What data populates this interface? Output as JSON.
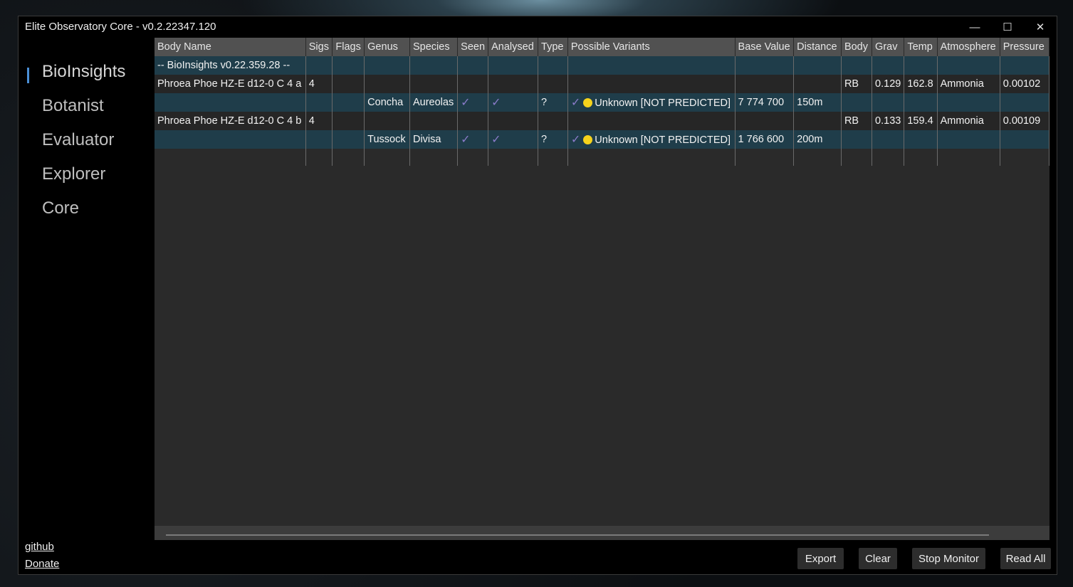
{
  "window": {
    "title": "Elite Observatory Core - v0.2.22347.120",
    "minimize_glyph": "—",
    "maximize_glyph": "☐",
    "close_glyph": "✕"
  },
  "sidebar": {
    "items": [
      {
        "label": "BioInsights",
        "active": true
      },
      {
        "label": "Botanist"
      },
      {
        "label": "Evaluator"
      },
      {
        "label": "Explorer"
      },
      {
        "label": "Core"
      }
    ],
    "links": {
      "github": "github",
      "donate": "Donate"
    }
  },
  "table": {
    "columns": [
      "Body Name",
      "Sigs",
      "Flags",
      "Genus",
      "Species",
      "Seen",
      "Analysed",
      "Type",
      "Possible Variants",
      "Base Value",
      "Distance",
      "Body",
      "Grav",
      "Temp",
      "Atmosphere",
      "Pressure"
    ],
    "rows": [
      {
        "body_name": "-- BioInsights v0.22.359.28  --",
        "sigs": "",
        "flags": "",
        "genus": "",
        "species": "",
        "seen": "",
        "analysed": "",
        "type": "",
        "variant_check": "",
        "variant": "",
        "base_value": "",
        "distance": "",
        "body": "",
        "grav": "",
        "temp": "",
        "atmosphere": "",
        "pressure": ""
      },
      {
        "body_name": "Phroea Phoe HZ-E d12-0 C 4 a",
        "sigs": "4",
        "flags": "",
        "genus": "",
        "species": "",
        "seen": "",
        "analysed": "",
        "type": "",
        "variant_check": "",
        "variant": "",
        "base_value": "",
        "distance": "",
        "body": "RB",
        "grav": "0.129",
        "temp": "162.8",
        "atmosphere": "Ammonia",
        "pressure": "0.00102"
      },
      {
        "body_name": "",
        "sigs": "",
        "flags": "",
        "genus": "Concha",
        "species": "Aureolas",
        "seen": "✓",
        "analysed": "✓",
        "type": "?",
        "variant_check": "✓",
        "variant": "Unknown [NOT PREDICTED]",
        "base_value": "7 774 700",
        "distance": "150m",
        "body": "",
        "grav": "",
        "temp": "",
        "atmosphere": "",
        "pressure": ""
      },
      {
        "body_name": "Phroea Phoe HZ-E d12-0 C 4 b",
        "sigs": "4",
        "flags": "",
        "genus": "",
        "species": "",
        "seen": "",
        "analysed": "",
        "type": "",
        "variant_check": "",
        "variant": "",
        "base_value": "",
        "distance": "",
        "body": "RB",
        "grav": "0.133",
        "temp": "159.4",
        "atmosphere": "Ammonia",
        "pressure": "0.00109"
      },
      {
        "body_name": "",
        "sigs": "",
        "flags": "",
        "genus": "Tussock",
        "species": "Divisa",
        "seen": "✓",
        "analysed": "✓",
        "type": "?",
        "variant_check": "✓",
        "variant": "Unknown [NOT PREDICTED]",
        "base_value": "1 766 600",
        "distance": "200m",
        "body": "",
        "grav": "",
        "temp": "",
        "atmosphere": "",
        "pressure": ""
      }
    ]
  },
  "buttons": {
    "export": "Export",
    "clear": "Clear",
    "stop_monitor": "Stop Monitor",
    "read_all": "Read All"
  },
  "colors": {
    "accent": "#4a8fd6",
    "row_highlight": "#1f3d4a",
    "check": "#8a7bc9",
    "dot": "#f5d31c"
  }
}
